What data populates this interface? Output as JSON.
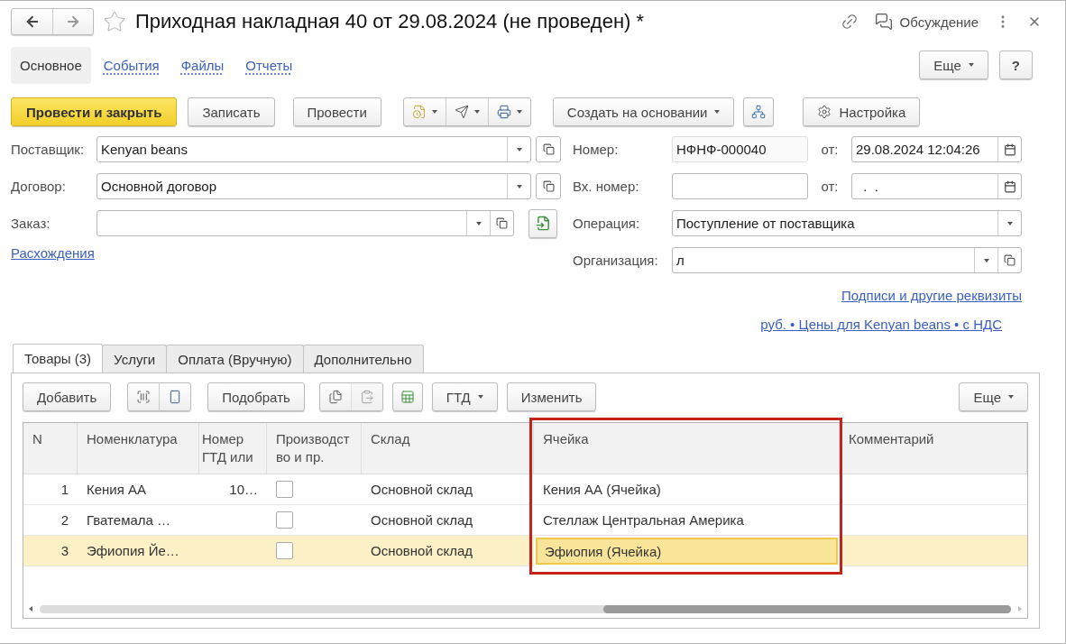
{
  "window": {
    "title": "Приходная накладная 40 от 29.08.2024 (не проведен) *",
    "favorite": false,
    "discussion": "Обсуждение"
  },
  "sections": [
    {
      "label": "Основное",
      "selected": true
    },
    {
      "label": "События",
      "selected": false
    },
    {
      "label": "Файлы",
      "selected": false
    },
    {
      "label": "Отчеты",
      "selected": false
    }
  ],
  "top_buttons": {
    "more": "Еще",
    "help": "?"
  },
  "commands": [
    {
      "kind": "primary",
      "label": "Провести и закрыть"
    },
    {
      "kind": "button",
      "label": "Записать"
    },
    {
      "kind": "button",
      "label": "Провести"
    },
    {
      "kind": "icon_group"
    },
    {
      "kind": "menu",
      "label": "Создать на основании"
    },
    {
      "kind": "structure"
    },
    {
      "kind": "settings",
      "label": "Настройка"
    }
  ],
  "fields_left": [
    {
      "kind": "ref",
      "label": "Поставщик:",
      "value": "Kenyan beans"
    },
    {
      "kind": "ref",
      "label": "Договор:",
      "value": "Основной договор"
    },
    {
      "kind": "ref_fill",
      "label": "Заказ:"
    }
  ],
  "discrepancies_link": "Расхождения",
  "fields_right": [
    {
      "kind": "number",
      "label": "Номер:",
      "value": "НФНФ-000040",
      "readonly": true,
      "date_label": "от:",
      "date": "29.08.2024 12:04:26"
    },
    {
      "kind": "number",
      "label": "Вх. номер:",
      "readonly": false,
      "date_label": "от:",
      "date": "  .  ."
    },
    {
      "kind": "select",
      "label": "Операция:",
      "value": "Поступление от поставщика"
    },
    {
      "kind": "ref",
      "label": "Организация:",
      "value": "л"
    }
  ],
  "links": [
    "Подписи и другие реквизиты",
    "руб. • Цены для Kenyan beans • с НДС"
  ],
  "tabs": [
    {
      "label": "Товары (3)",
      "selected": true
    },
    {
      "label": "Услуги",
      "selected": false
    },
    {
      "label": "Оплата (Вручную)",
      "selected": false
    },
    {
      "label": "Дополнительно",
      "selected": false
    }
  ],
  "toolbar": [
    {
      "kind": "button",
      "label": "Добавить"
    },
    {
      "kind": "scan_group"
    },
    {
      "kind": "button",
      "label": "Подобрать"
    },
    {
      "kind": "copy_group",
      "paste_disabled": true
    },
    {
      "kind": "fill"
    },
    {
      "kind": "menu",
      "label": "ГТД"
    },
    {
      "kind": "button",
      "label": "Изменить"
    }
  ],
  "toolbar_more": "Еще",
  "table": {
    "columns": [
      {
        "kind": "number",
        "label": "N",
        "highlighted": false
      },
      {
        "kind": "text",
        "label": "Номенклатура",
        "highlighted": false
      },
      {
        "kind": "number",
        "label": "Номер ГТД или",
        "highlighted": false
      },
      {
        "kind": "checkbox",
        "label": "Производство и пр.",
        "highlighted": false
      },
      {
        "kind": "text",
        "label": "Склад",
        "highlighted": false
      },
      {
        "kind": "text",
        "label": "Ячейка",
        "highlighted": true
      },
      {
        "kind": "text",
        "label": "Комментарий",
        "highlighted": false
      }
    ],
    "rows": [
      {
        "cells": [
          "1",
          "Кения АА",
          "10…",
          false,
          "Основной склад",
          "Кения АА (Ячейка)"
        ],
        "selected": false,
        "cell_focused": false
      },
      {
        "cells": [
          "2",
          "Гватемала …",
          null,
          false,
          "Основной склад",
          "Стеллаж Центральная Америка"
        ],
        "selected": false,
        "cell_focused": false
      },
      {
        "cells": [
          "3",
          "Эфиопия Йе…",
          null,
          false,
          "Основной склад",
          "Эфиопия (Ячейка)"
        ],
        "selected": true,
        "cell_focused": true
      }
    ]
  }
}
